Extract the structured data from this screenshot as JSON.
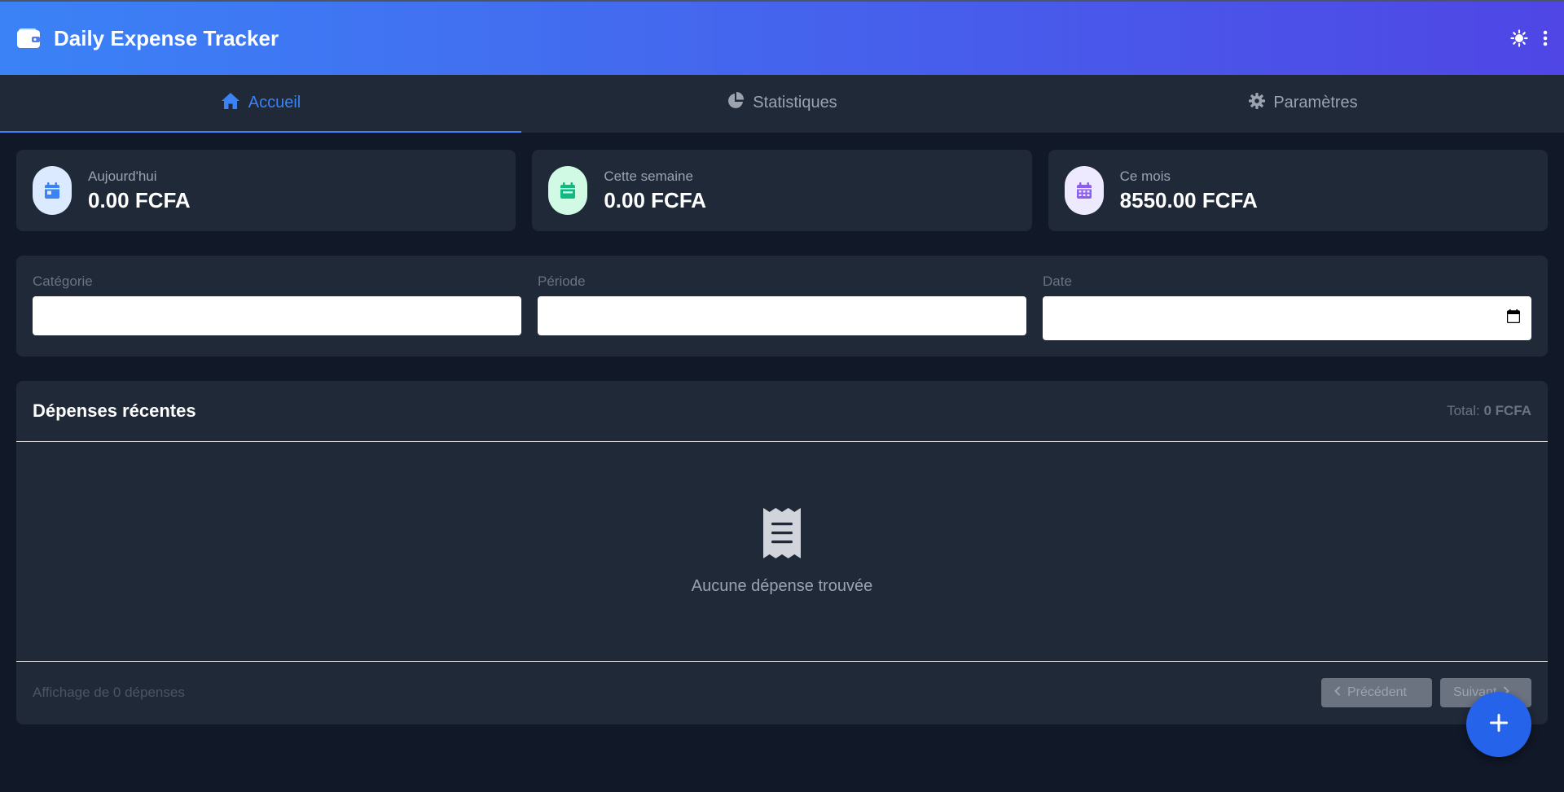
{
  "app": {
    "title": "Daily Expense Tracker"
  },
  "tabs": [
    {
      "label": "Accueil",
      "icon": "home-icon",
      "active": true
    },
    {
      "label": "Statistiques",
      "icon": "chart-pie-icon",
      "active": false
    },
    {
      "label": "Paramètres",
      "icon": "gear-icon",
      "active": false
    }
  ],
  "stats": [
    {
      "label": "Aujourd'hui",
      "value": "0.00 FCFA",
      "icon": "calendar-day-icon",
      "color": "#3b82f6",
      "bg": "#dbeafe"
    },
    {
      "label": "Cette semaine",
      "value": "0.00 FCFA",
      "icon": "calendar-week-icon",
      "color": "#10b981",
      "bg": "#d1fae5"
    },
    {
      "label": "Ce mois",
      "value": "8550.00 FCFA",
      "icon": "calendar-month-icon",
      "color": "#8b5cf6",
      "bg": "#ede9fe"
    }
  ],
  "filters": {
    "category": {
      "label": "Catégorie",
      "value": ""
    },
    "period": {
      "label": "Période",
      "value": ""
    },
    "date": {
      "label": "Date",
      "value": ""
    }
  },
  "expenses": {
    "title": "Dépenses récentes",
    "total_label": "Total:",
    "total_value": "0 FCFA",
    "empty_text": "Aucune dépense trouvée",
    "footer_text": "Affichage de 0 dépenses",
    "prev_label": "Précédent",
    "next_label": "Suivant"
  },
  "colors": {
    "accent": "#3b82f6",
    "header_gradient_start": "#3b82f6",
    "header_gradient_end": "#4f46e5",
    "fab": "#2563eb"
  }
}
